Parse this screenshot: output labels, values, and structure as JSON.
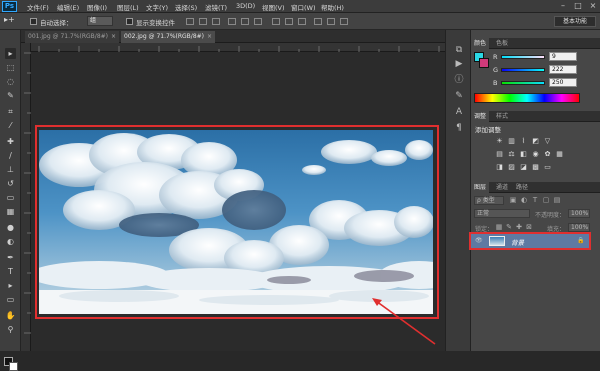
{
  "app": {
    "logo": "Ps"
  },
  "menu": [
    "文件(F)",
    "编辑(E)",
    "图像(I)",
    "图层(L)",
    "文字(Y)",
    "选择(S)",
    "滤镜(T)",
    "3D(D)",
    "视图(V)",
    "窗口(W)",
    "帮助(H)"
  ],
  "window_controls": {
    "minimize": "–",
    "maximize": "□",
    "close": "×"
  },
  "options": {
    "auto_select_label": "自动选择：",
    "auto_select_value": "组",
    "show_transform_label": "显示变换控件",
    "workspace": "基本功能"
  },
  "tabs": [
    {
      "label": "001.jpg @ 71.7%(RGB/8#)",
      "close": "×"
    },
    {
      "label": "002.jpg @ 71.7%(RGB/8#)",
      "close": "×"
    }
  ],
  "color_panel": {
    "tabs": [
      "颜色",
      "色板"
    ],
    "foreground": "#2ad7e4",
    "r": {
      "label": "R",
      "value": "9"
    },
    "g": {
      "label": "G",
      "value": "222"
    },
    "b": {
      "label": "B",
      "value": "250"
    }
  },
  "adjust_panel": {
    "tabs": [
      "调整",
      "样式"
    ],
    "title": "添加调整"
  },
  "layers_panel": {
    "tabs": [
      "图层",
      "通道",
      "路径"
    ],
    "kind_label": "ρ 类型",
    "blend_mode": "正常",
    "opacity_label": "不透明度：",
    "opacity_value": "100%",
    "lock_label": "锁定：",
    "fill_label": "填充：",
    "fill_value": "100%",
    "layer_name": "背景",
    "eye_icon": "👁",
    "lock_icon": "🔒"
  },
  "colors": {
    "highlight": "#e02f2f",
    "accent": "#31a8ff",
    "selected_layer": "#5e7aa2"
  }
}
